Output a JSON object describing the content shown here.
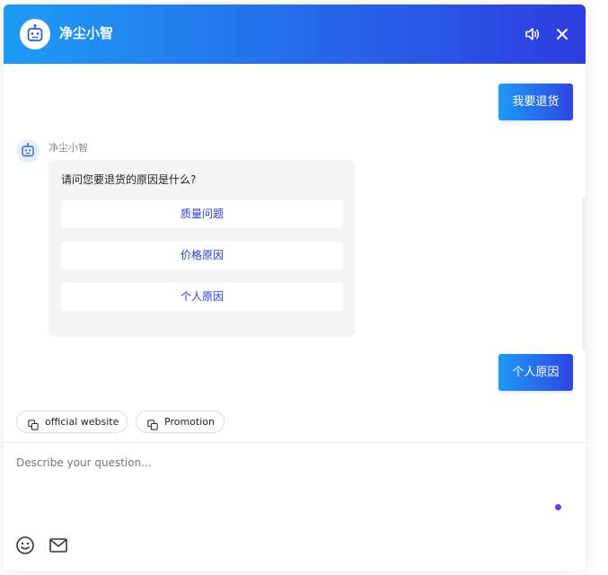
{
  "header": {
    "title": "净尘小智",
    "avatar_icon": "robot-icon",
    "sound_icon": "speaker-icon",
    "close_icon": "close-icon",
    "gradient": [
      "#1e9bf5",
      "#2e3de0"
    ]
  },
  "conversation": {
    "user_message_1": "我要退货",
    "bot": {
      "name": "净尘小智",
      "question": "请问您要退货的原因是什么?",
      "options": [
        "质量问题",
        "价格原因",
        "个人原因"
      ]
    },
    "user_message_2": "个人原因"
  },
  "quick_links": [
    {
      "label": "official website",
      "icon": "link-icon"
    },
    {
      "label": "Promotion",
      "icon": "link-icon"
    }
  ],
  "composer": {
    "placeholder": "Describe your question...",
    "value": "",
    "emoji_icon": "smile-icon",
    "mail_icon": "mail-icon"
  },
  "colors": {
    "accent": "#2e46e3",
    "option_text": "#2a3bd6",
    "status_dot": "#6a3fd8"
  }
}
